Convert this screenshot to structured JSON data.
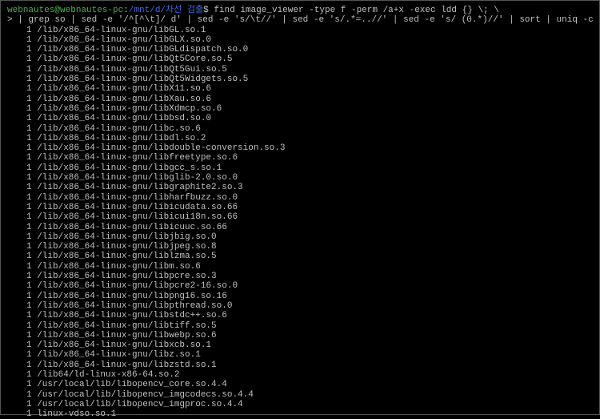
{
  "prompt": {
    "user_host": "webnautes@webnautes-pc",
    "colon": ":",
    "path": "/mnt/d/차선 검출",
    "dollar": "$",
    "command1": " find image_viewer -type f -perm /a+x -exec ldd {} \\; \\",
    "cont": ">",
    "command2": " | grep so | sed -e '/^[^\\t]/ d' | sed -e 's/\\t//' | sed -e 's/.*=..//' | sed -e 's/ (0.*)//' | sort | uniq -c | sort -n"
  },
  "lines": [
    "1 /lib/x86_64-linux-gnu/libGL.so.1",
    "1 /lib/x86_64-linux-gnu/libGLX.so.0",
    "1 /lib/x86_64-linux-gnu/libGLdispatch.so.0",
    "1 /lib/x86_64-linux-gnu/libQt5Core.so.5",
    "1 /lib/x86_64-linux-gnu/libQt5Gui.so.5",
    "1 /lib/x86_64-linux-gnu/libQt5Widgets.so.5",
    "1 /lib/x86_64-linux-gnu/libX11.so.6",
    "1 /lib/x86_64-linux-gnu/libXau.so.6",
    "1 /lib/x86_64-linux-gnu/libXdmcp.so.6",
    "1 /lib/x86_64-linux-gnu/libbsd.so.0",
    "1 /lib/x86_64-linux-gnu/libc.so.6",
    "1 /lib/x86_64-linux-gnu/libdl.so.2",
    "1 /lib/x86_64-linux-gnu/libdouble-conversion.so.3",
    "1 /lib/x86_64-linux-gnu/libfreetype.so.6",
    "1 /lib/x86_64-linux-gnu/libgcc_s.so.1",
    "1 /lib/x86_64-linux-gnu/libglib-2.0.so.0",
    "1 /lib/x86_64-linux-gnu/libgraphite2.so.3",
    "1 /lib/x86_64-linux-gnu/libharfbuzz.so.0",
    "1 /lib/x86_64-linux-gnu/libicudata.so.66",
    "1 /lib/x86_64-linux-gnu/libicui18n.so.66",
    "1 /lib/x86_64-linux-gnu/libicuuc.so.66",
    "1 /lib/x86_64-linux-gnu/libjbig.so.0",
    "1 /lib/x86_64-linux-gnu/libjpeg.so.8",
    "1 /lib/x86_64-linux-gnu/liblzma.so.5",
    "1 /lib/x86_64-linux-gnu/libm.so.6",
    "1 /lib/x86_64-linux-gnu/libpcre.so.3",
    "1 /lib/x86_64-linux-gnu/libpcre2-16.so.0",
    "1 /lib/x86_64-linux-gnu/libpng16.so.16",
    "1 /lib/x86_64-linux-gnu/libpthread.so.0",
    "1 /lib/x86_64-linux-gnu/libstdc++.so.6",
    "1 /lib/x86_64-linux-gnu/libtiff.so.5",
    "1 /lib/x86_64-linux-gnu/libwebp.so.6",
    "1 /lib/x86_64-linux-gnu/libxcb.so.1",
    "1 /lib/x86_64-linux-gnu/libz.so.1",
    "1 /lib/x86_64-linux-gnu/libzstd.so.1",
    "1 /lib64/ld-linux-x86-64.so.2",
    "1 /usr/local/lib/libopencv_core.so.4.4",
    "1 /usr/local/lib/libopencv_imgcodecs.so.4.4",
    "1 /usr/local/lib/libopencv_imgproc.so.4.4",
    "1 linux-vdso.so.1"
  ]
}
